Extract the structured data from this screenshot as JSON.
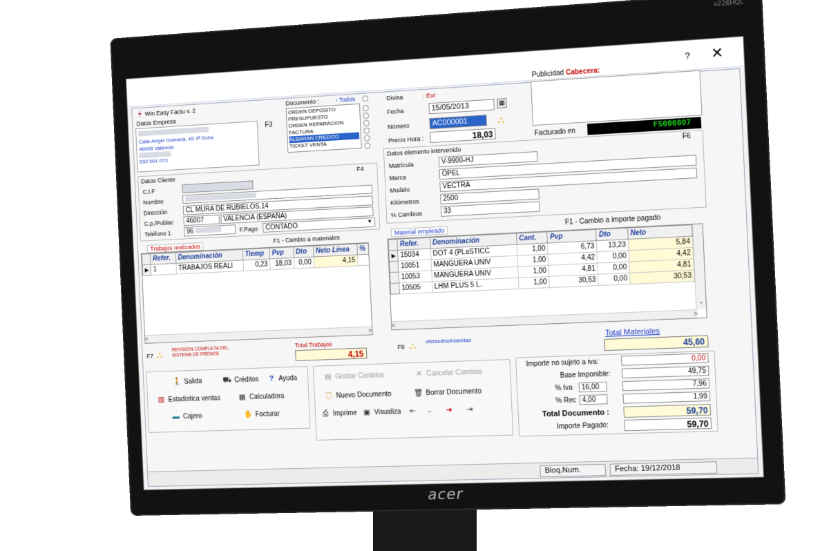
{
  "monitor": {
    "model": "v226HQL",
    "brand": "acer"
  },
  "window": {
    "help_button": "?",
    "close_button": "✕"
  },
  "app": {
    "title": "Win Easy Factu v. 2"
  },
  "empresa": {
    "label": "Datos Empresa",
    "hotkey": "F3",
    "lines": [
      "Calle Angel Guimerà, 45 3ª Dcha",
      "46008 Valencia",
      "932 001 073"
    ]
  },
  "documento": {
    "label": "Documento :",
    "todos_label": "Todos",
    "options": [
      "ORDEN DEPOSITO",
      "PRESUPUESTO",
      "ORDEN REPARACION",
      "FACTURA",
      "ALBARAN CREDITO",
      "TICKET VENTA"
    ],
    "selected_index": 4
  },
  "header": {
    "divisa_label": "Divisa",
    "divisa_value": ": Eur",
    "fecha_label": "Fecha",
    "fecha_value": "15/05/2013",
    "numero_label": "Número",
    "numero_value": "AC000001",
    "precio_label": "Precio Hora :",
    "precio_value": "18,03"
  },
  "publicidad": {
    "label": "Publicidad",
    "label_red": "Cabecera:"
  },
  "facturado": {
    "label": "Facturado en",
    "value": "FS000007"
  },
  "cliente": {
    "label": "Datos Cliente",
    "hotkey": "F4",
    "cif_label": "C.I.F",
    "cif_value": "",
    "nombre_label": "Nombre",
    "nombre_value": "",
    "direccion_label": "Dirección",
    "direccion_value": "CL MURA DE RUBIELOS,14",
    "cp_label": "C.p./Poblac",
    "cp_value": "46007",
    "poblacion_value": "VALENCIA (ESPAÑA)",
    "telefono_label": "Teléfono 1",
    "telefono_value": "96",
    "fpago_label": "F.Pago",
    "fpago_value": "CONTADO"
  },
  "vehiculo": {
    "label": "Datos elemento intervenido",
    "hotkey": "F6",
    "matricula_label": "Matrícula",
    "matricula_value": "V-9900-HJ",
    "marca_label": "Marca",
    "marca_value": "OPEL",
    "modelo_label": "Modelo",
    "modelo_value": "VECTRA",
    "km_label": "Kilómetros",
    "km_value": "2500",
    "cambios_label": "% Cambios",
    "cambios_value": "33"
  },
  "trabajos": {
    "tab_label": "Trabajos realizados",
    "f1_label": "F1 - Cambio a materiales",
    "columns": [
      "Refer.",
      "Denominación",
      "Tiemp",
      "Pvp",
      "Dto",
      "Neto Línea",
      "%"
    ],
    "rows": [
      [
        "1",
        "TRABAJOS REALI",
        "0,23",
        "18,03",
        "0,00",
        "4,15",
        ""
      ]
    ],
    "f7_label": "F7",
    "note": "REVISION COMPLETA DEL SISTEMA DE FRENOS",
    "total_label": "Total Trabajos",
    "total_value": "4,15"
  },
  "materiales": {
    "tab_label": "Material empleado",
    "f1_label": "F1 - Cambio a importe pagado",
    "columns": [
      "Refer.",
      "Denominación",
      "Cant.",
      "Pvp",
      "Dto",
      "Neto"
    ],
    "rows": [
      [
        "15034",
        "DOT 4 (PLaSTICC",
        "1,00",
        "6,73",
        "13,23",
        "5,84"
      ],
      [
        "10051",
        "MANGUERA UNIV",
        "1,00",
        "4,42",
        "0,00",
        "4,42"
      ],
      [
        "10053",
        "MANGUERA UNIV",
        "1,00",
        "4,81",
        "0,00",
        "4,81"
      ],
      [
        "10505",
        "LHM PLUS 5 L.",
        "1,00",
        "30,53",
        "0,00",
        "30,53"
      ]
    ],
    "f8_label": "F8",
    "note": "dfsfasdfasfdasfdas",
    "total_label": "Total Materiales",
    "total_value": "45,60"
  },
  "menu_buttons": {
    "salida": "Salida",
    "creditos": "Créditos",
    "ayuda": "Ayuda",
    "estadistica": "Estadística ventas",
    "calculadora": "Calculadora",
    "cajero": "Cajero",
    "facturar": "Facturar"
  },
  "doc_buttons": {
    "grabar": "Grabar Cambios",
    "cancelar": "Cancelar Cambios",
    "nuevo": "Nuevo Documento",
    "borrar": "Borrar Documento",
    "imprimir": "Imprime",
    "visualiza": "Visualiza"
  },
  "totals": {
    "importe_no_sujeto_label": "Importe no sujeto a iva:",
    "importe_no_sujeto_value": "0,00",
    "base_label": "Base Imponible:",
    "base_value": "49,75",
    "iva_label": "% Iva",
    "iva_pct": "16,00",
    "iva_value": "7,96",
    "rec_label": "% Rec",
    "rec_pct": "4,00",
    "rec_value": "1,99",
    "total_doc_label": "Total Documento :",
    "total_doc_value": "59,70",
    "pagado_label": "Importe Pagado:",
    "pagado_value": "59,70"
  },
  "status": {
    "bloq": "Bloq.Num.",
    "fecha": "Fecha: 19/12/2018"
  }
}
